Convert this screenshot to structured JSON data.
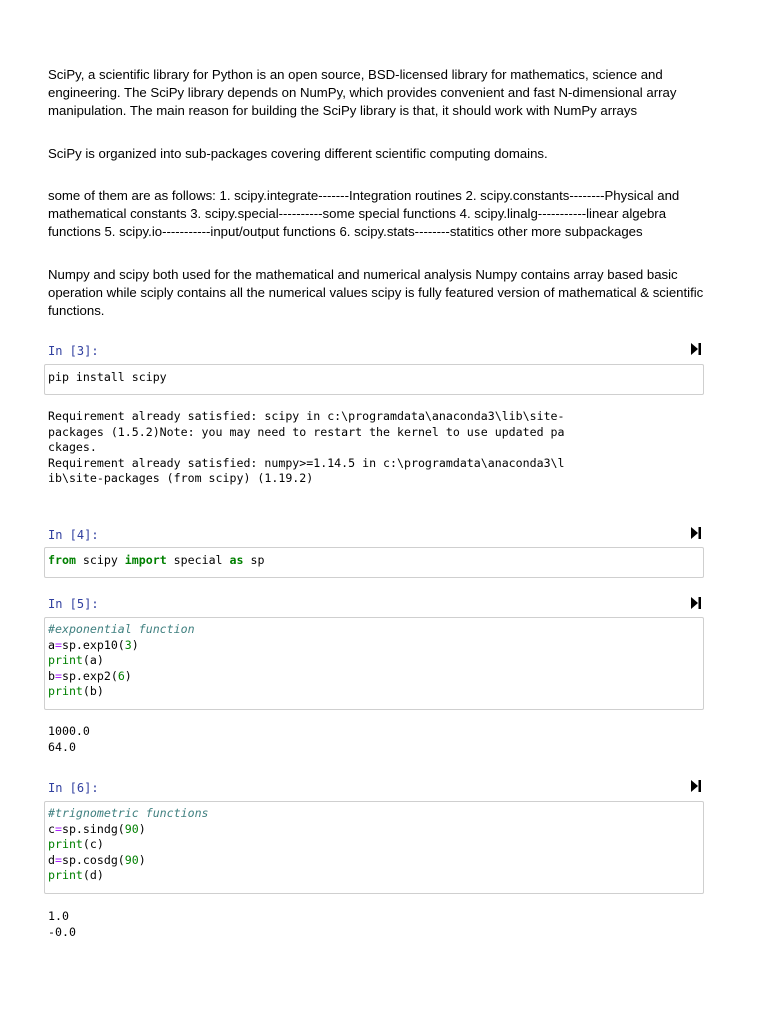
{
  "markdown": {
    "p1": "SciPy, a scientific library for Python is an open source, BSD-licensed library for mathematics, science and engineering. The SciPy library depends on NumPy, which provides convenient and fast N-dimensional array manipulation. The main reason for building the SciPy library is that, it should work with NumPy arrays",
    "p2": "SciPy is organized into sub-packages covering different scientific computing domains.",
    "p3": "some of them are as follows: 1. scipy.integrate-------Integration routines 2. scipy.constants--------Physical and mathematical constants 3. scipy.special----------some special functions 4. scipy.linalg-----------linear algebra functions 5. scipy.io-----------input/output functions 6. scipy.stats--------statitics other more subpackages",
    "p4": "Numpy and scipy both used for the mathematical and numerical analysis Numpy contains array based basic operation while sciply contains all the numerical values scipy is fully featured version of mathematical & scientific functions."
  },
  "cells": [
    {
      "prompt": "In [3]:",
      "code_line1": "pip install scipy",
      "output": "Requirement already satisfied: scipy in c:\\programdata\\anaconda3\\lib\\site-\npackages (1.5.2)Note: you may need to restart the kernel to use updated pa\nckages.\nRequirement already satisfied: numpy>=1.14.5 in c:\\programdata\\anaconda3\\l\nib\\site-packages (from scipy) (1.19.2)"
    },
    {
      "prompt": "In [4]:",
      "kw_from": "from",
      "mod": "scipy",
      "kw_import": "import",
      "name": "special",
      "kw_as": "as",
      "alias": "sp"
    },
    {
      "prompt": "In [5]:",
      "comment": "#exponential function",
      "l2_var": "a",
      "l2_call": "sp.exp10(",
      "l2_num": "3",
      "l3_print": "print",
      "l3_arg": "(a)",
      "l4_var": "b",
      "l4_call": "sp.exp2(",
      "l4_num": "6",
      "l5_print": "print",
      "l5_arg": "(b)",
      "output": "1000.0\n64.0"
    },
    {
      "prompt": "In [6]:",
      "comment": "#trignometric functions",
      "l2_var": "c",
      "l2_call": "sp.sindg(",
      "l2_num": "90",
      "l3_print": "print",
      "l3_arg": "(c)",
      "l4_var": "d",
      "l4_call": "sp.cosdg(",
      "l4_num": "90",
      "l5_print": "print",
      "l5_arg": "(d)",
      "output": "1.0\n-0.0"
    }
  ],
  "icons": {
    "run": "run-cell-icon"
  }
}
